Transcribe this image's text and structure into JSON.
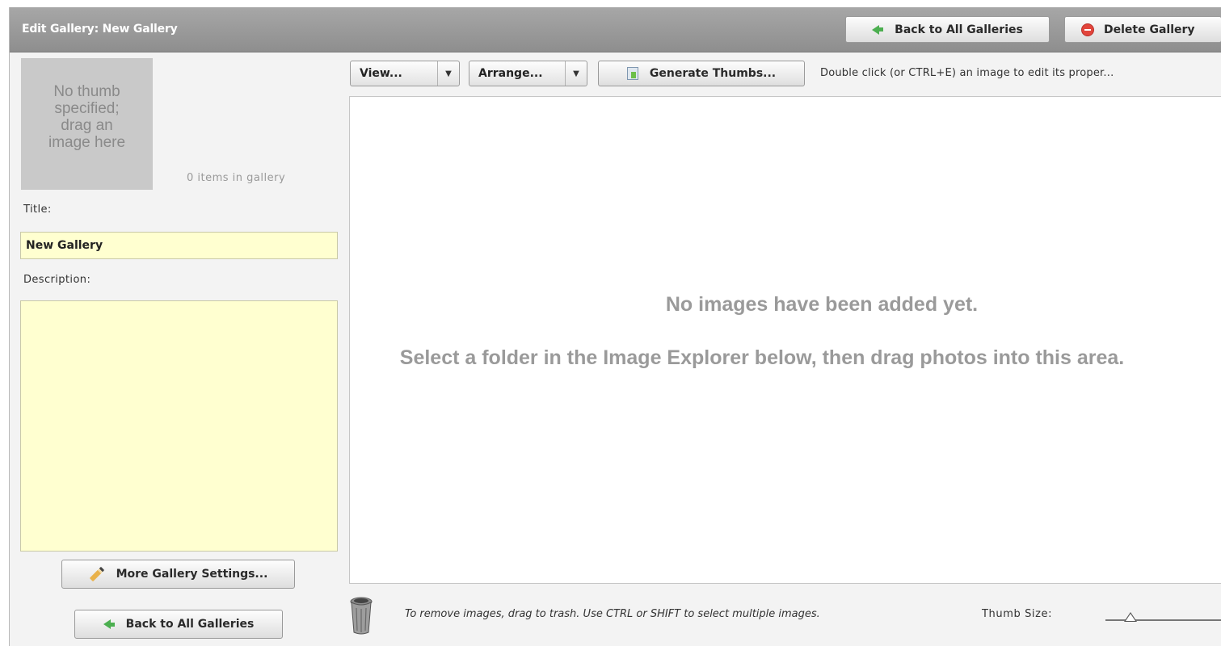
{
  "header": {
    "title": "Edit Gallery: New Gallery",
    "back_label": "Back to All Galleries",
    "delete_label": "Delete Gallery"
  },
  "left_panel": {
    "thumb_placeholder": "No thumb specified; drag an image here",
    "item_count": "0 items in gallery",
    "title_label": "Title:",
    "title_value": "New Gallery",
    "description_label": "Description:",
    "description_value": "",
    "more_settings_label": "More Gallery Settings...",
    "back_label": "Back to All Galleries"
  },
  "toolbar": {
    "view_label": "View...",
    "arrange_label": "Arrange...",
    "generate_label": "Generate Thumbs...",
    "hint": "Double click (or CTRL+E) an image to edit its proper..."
  },
  "drop_area": {
    "empty_title": "No images have been added yet.",
    "empty_instructions": "Select a folder in the Image Explorer below, then drag photos into this area."
  },
  "bottom_bar": {
    "trash_note": "To remove images, drag to trash.  Use CTRL or SHIFT to select multiple images.",
    "thumb_size_label": "Thumb Size:",
    "thumb_size_level": 0.2
  },
  "icons": {
    "back": "green-left-arrow-icon",
    "delete": "red-minus-circle-icon",
    "more_settings": "pencil-icon",
    "generate": "image-document-icon",
    "trash": "trash-can-icon"
  },
  "colors": {
    "header_bg": "#9b9b9b",
    "input_bg": "#ffffd0",
    "accent_green": "#4caf50",
    "delete_red": "#e2453c"
  }
}
